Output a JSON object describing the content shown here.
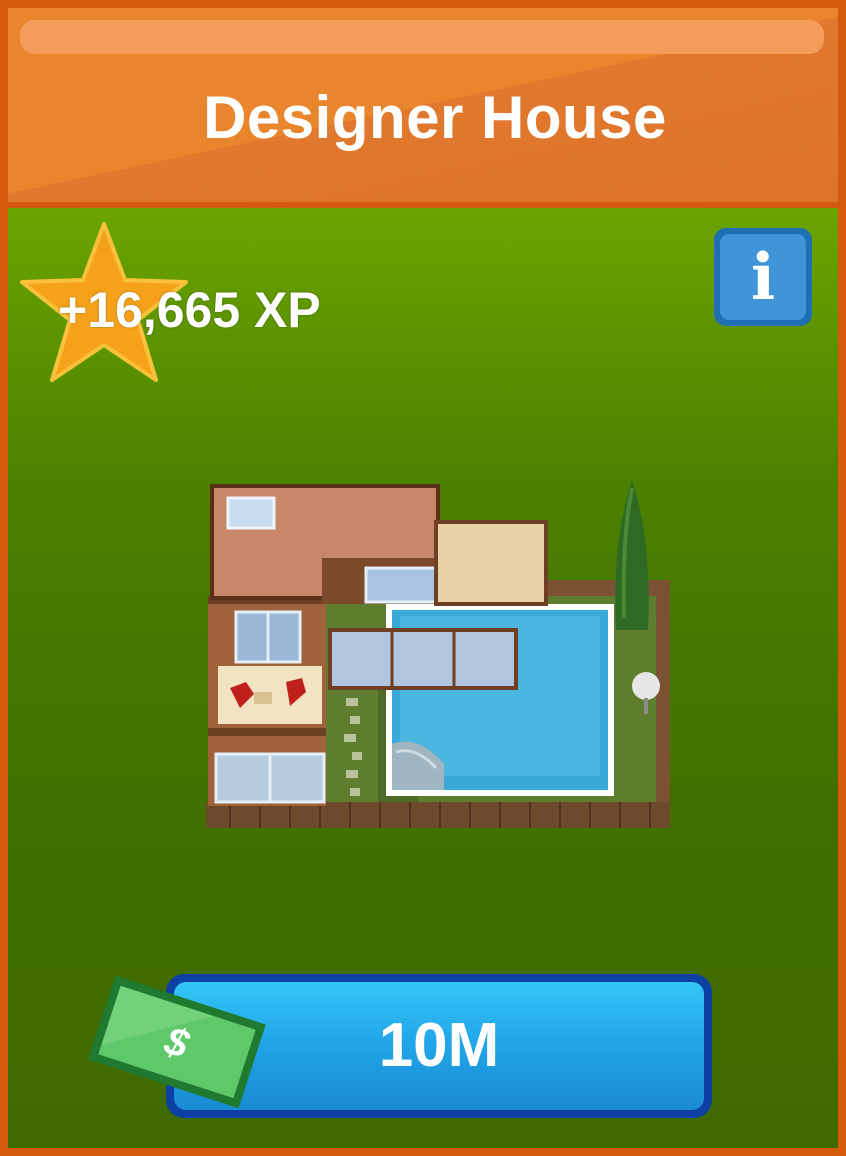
{
  "card": {
    "title": "Designer House",
    "xp_reward": "+16,665 XP",
    "info_glyph": "i",
    "price": "10M",
    "currency_symbol": "$"
  },
  "icons": {
    "reward": "star-icon",
    "info": "info-icon",
    "currency": "cash-bill-icon",
    "item": "designer-house-image"
  },
  "colors": {
    "frame": "#d45a0e",
    "header": "#e9852c",
    "panel_top": "#6ba400",
    "panel_bottom": "#3f6a00",
    "star": "#f5a21a",
    "info_button": "#3f95d8",
    "buy_button": "#22a7ea",
    "cash": "#2e9a3e"
  }
}
